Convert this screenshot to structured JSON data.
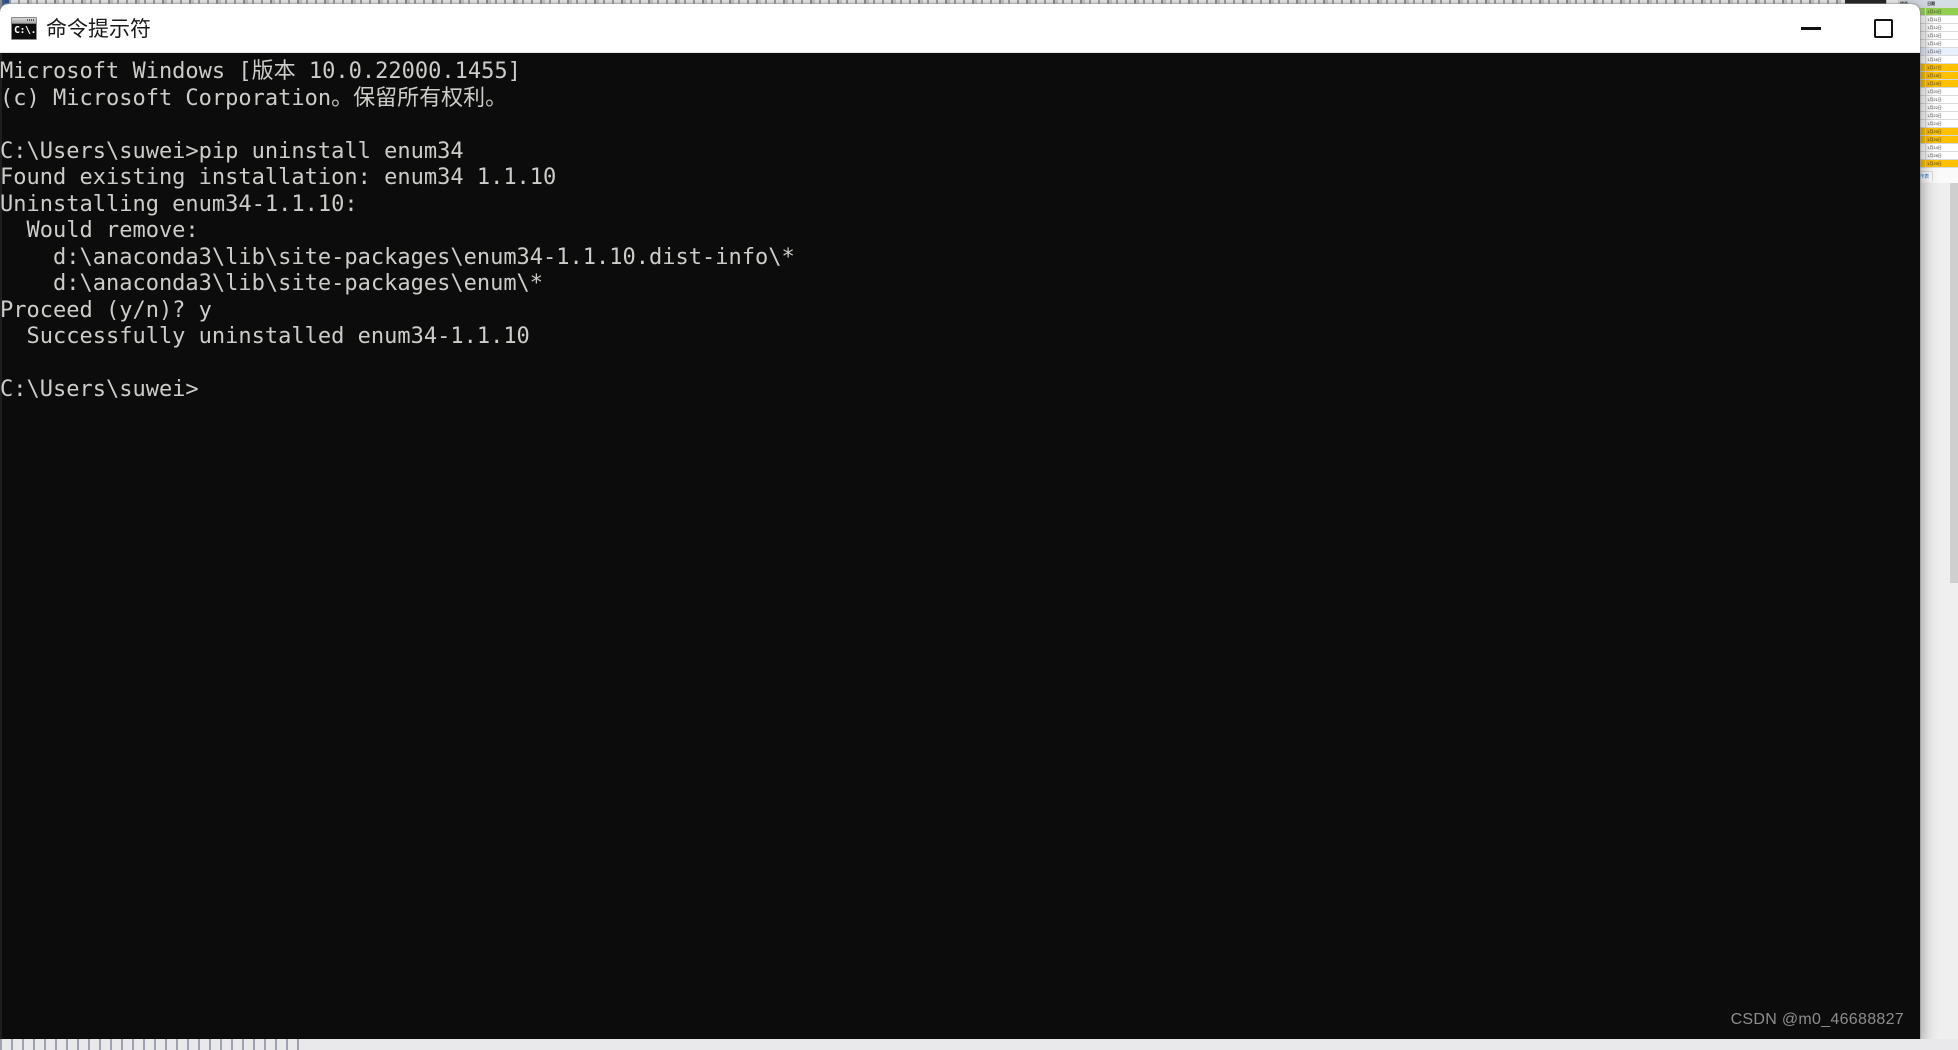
{
  "window": {
    "title": "命令提示符",
    "icon": "cmd-console-icon",
    "icon_glyph": "C:\\.",
    "controls": {
      "minimize_label": "—",
      "maximize_label": "□"
    }
  },
  "console": {
    "prompt_user_path": "C:\\Users\\suwei>",
    "cursor_line": 12,
    "lines": [
      "Microsoft Windows [版本 10.0.22000.1455]",
      "(c) Microsoft Corporation。保留所有权利。",
      "",
      "C:\\Users\\suwei>pip uninstall enum34",
      "Found existing installation: enum34 1.1.10",
      "Uninstalling enum34-1.1.10:",
      "  Would remove:",
      "    d:\\anaconda3\\lib\\site-packages\\enum34-1.1.10.dist-info\\*",
      "    d:\\anaconda3\\lib\\site-packages\\enum\\*",
      "Proceed (y/n)? y",
      "  Successfully uninstalled enum34-1.1.10",
      "",
      "C:\\Users\\suwei>"
    ],
    "text_color": "#ccccc8",
    "background_color": "#0c0c0c"
  },
  "background_sheet": {
    "header": [
      "状态",
      "日期"
    ],
    "rows": [
      {
        "c1": "未完成",
        "c2": "1月10日",
        "style": "green"
      },
      {
        "c1": "未完成",
        "c2": "1月11日",
        "style": "plain"
      },
      {
        "c1": "已完成",
        "c2": "1月12日",
        "style": "plain"
      },
      {
        "c1": "未完成",
        "c2": "1月13日",
        "style": "plain"
      },
      {
        "c1": "未完成",
        "c2": "1月14日",
        "style": "plain"
      },
      {
        "c1": "未完成",
        "c2": "1月15日",
        "style": "sel"
      },
      {
        "c1": "已完成",
        "c2": "1月16日",
        "style": "plain"
      },
      {
        "c1": "未完成",
        "c2": "1月17日",
        "style": "orange"
      },
      {
        "c1": "未完成",
        "c2": "1月18日",
        "style": "orange"
      },
      {
        "c1": "已完成",
        "c2": "1月19日",
        "style": "orange"
      },
      {
        "c1": "已完成",
        "c2": "1月20日",
        "style": "plain"
      },
      {
        "c1": "未完成",
        "c2": "1月21日",
        "style": "plain"
      },
      {
        "c1": "未完成",
        "c2": "1月22日",
        "style": "plain"
      },
      {
        "c1": "已完成",
        "c2": "1月23日",
        "style": "plain"
      },
      {
        "c1": "未完成",
        "c2": "1月24日",
        "style": "plain"
      },
      {
        "c1": "未完成",
        "c2": "1月25日",
        "style": "orange"
      },
      {
        "c1": "已完成",
        "c2": "1月26日",
        "style": "orange"
      },
      {
        "c1": "已完成",
        "c2": "1月14日",
        "style": "plain"
      },
      {
        "c1": "未完成",
        "c2": "1月28日",
        "style": "plain"
      },
      {
        "c1": "未完成",
        "c2": "1月29日",
        "style": "orange"
      },
      {
        "c1": "已完成",
        "c2": "1月30日",
        "style": "plain"
      }
    ],
    "bottom_bar": {
      "list_icon": "≔",
      "add_icon": "+",
      "tab_label": "工作表"
    }
  },
  "watermark": {
    "text": "CSDN @m0_46688827"
  },
  "colors": {
    "console_bg": "#0c0c0c",
    "console_fg": "#ccccc8",
    "titlebar_bg": "#ffffff",
    "desktop": "#efefef",
    "sheet_green": "#92d050",
    "sheet_orange": "#ffc000"
  }
}
